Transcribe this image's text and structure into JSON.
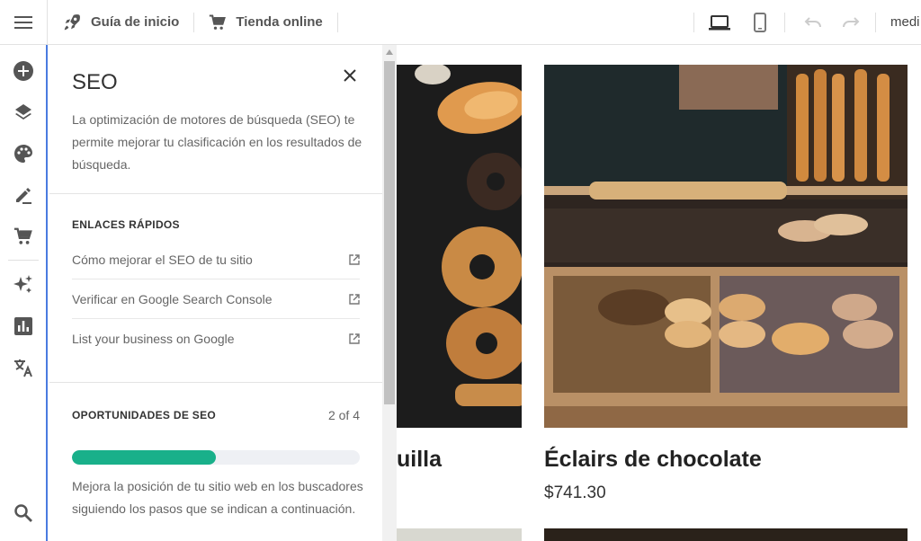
{
  "topbar": {
    "guide_label": "Guía de inicio",
    "store_label": "Tienda online",
    "right_label": "medi"
  },
  "panel": {
    "title": "SEO",
    "description": "La optimización de motores de búsqueda (SEO) te permite mejorar tu clasificación en los resultados de búsqueda.",
    "quick_links": {
      "title": "ENLACES RÁPIDOS",
      "items": [
        {
          "label": "Cómo mejorar el SEO de tu sitio"
        },
        {
          "label": "Verificar en Google Search Console"
        },
        {
          "label": "List your business on Google"
        }
      ]
    },
    "opportunities": {
      "title": "OPORTUNIDADES DE SEO",
      "count": "2 of 4",
      "progress_fraction": 0.5,
      "description": "Mejora la posición de tu sitio web en los buscadores siguiendo los pasos que se indican a continuación."
    }
  },
  "canvas": {
    "products": [
      {
        "name": "uilla",
        "price": ""
      },
      {
        "name": "Éclairs de chocolate",
        "price": "$741.30"
      }
    ]
  },
  "colors": {
    "accent": "#4a7be0",
    "progress": "#19b08a"
  }
}
